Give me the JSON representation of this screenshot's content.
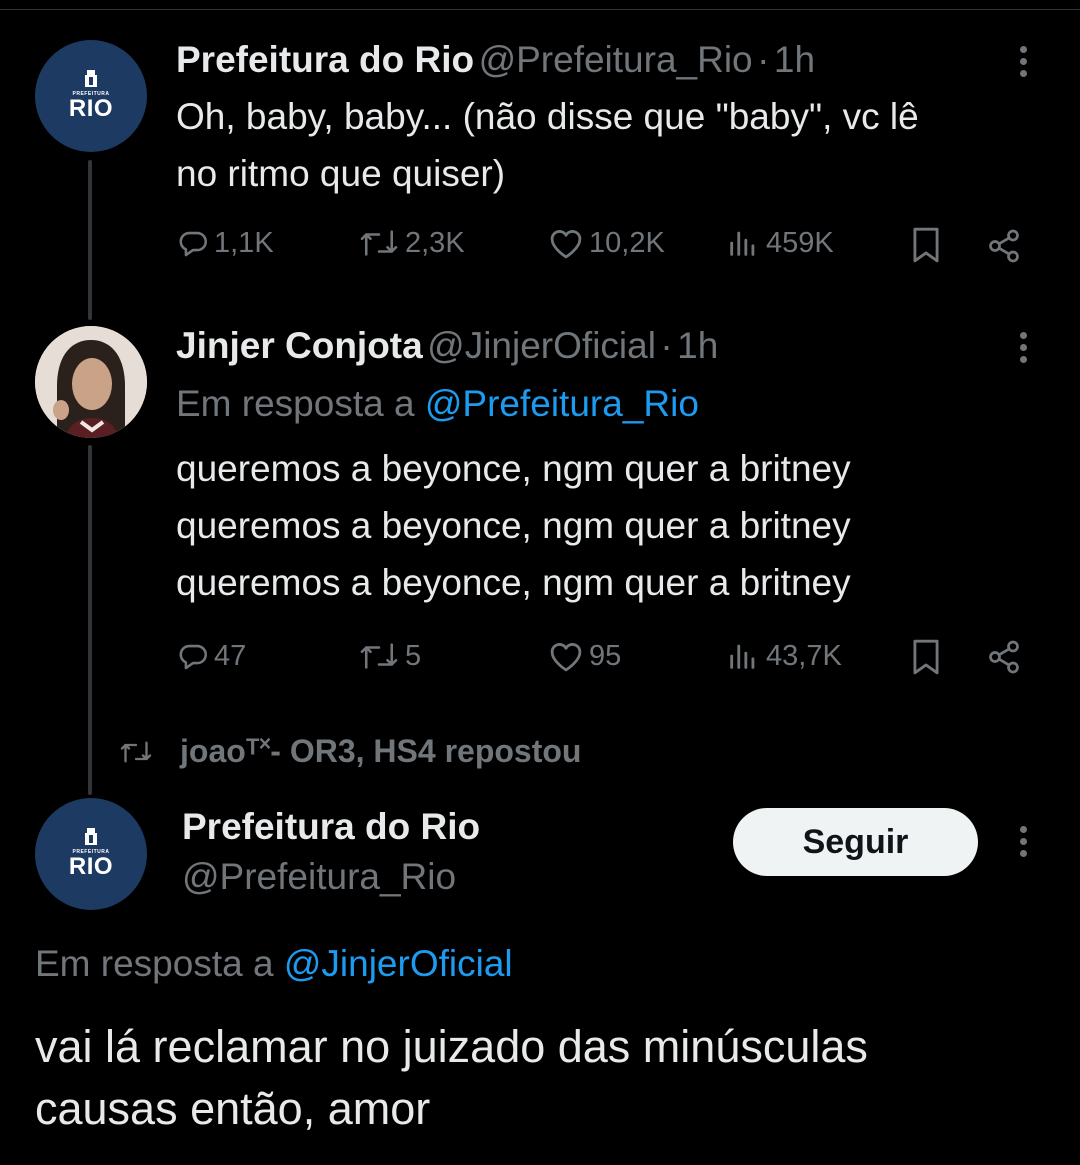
{
  "tweet1": {
    "avatar": {
      "small": "PREFEITURA",
      "big": "RIO"
    },
    "name": "Prefeitura do Rio",
    "handle": "@Prefeitura_Rio",
    "separator": "·",
    "time": "1h",
    "text_line1": "Oh, baby, baby... (não disse que \"baby\", vc lê",
    "text_line2": "no ritmo que quiser)",
    "replies": "1,1K",
    "retweets": "2,3K",
    "likes": "10,2K",
    "views": "459K"
  },
  "tweet2": {
    "name": "Jinjer Conjota",
    "handle": "@JinjerOficial",
    "separator": "·",
    "time": "1h",
    "reply_prefix": "Em resposta a",
    "reply_to": "@Prefeitura_Rio",
    "lines": [
      "queremos a beyonce, ngm quer a britney",
      "queremos a beyonce, ngm quer a britney",
      "queremos a beyonce, ngm quer a britney"
    ],
    "replies": "47",
    "retweets": "5",
    "likes": "95",
    "views": "43,7K"
  },
  "repost_banner": "joaoᵀ˟- OR3, HS4 repostou",
  "tweet3": {
    "avatar": {
      "small": "PREFEITURA",
      "big": "RIO"
    },
    "name": "Prefeitura do Rio",
    "handle": "@Prefeitura_Rio",
    "follow_label": "Seguir",
    "reply_prefix": "Em resposta a",
    "reply_to": "@JinjerOficial",
    "text_line1": "vai lá reclamar no juizado das minúsculas",
    "text_line2": "causas então, amor"
  },
  "colors": {
    "background": "#000000",
    "text": "#e7e9ea",
    "muted": "#71767b",
    "link": "#1d9bf0",
    "rio_blue": "#1d3a63"
  }
}
